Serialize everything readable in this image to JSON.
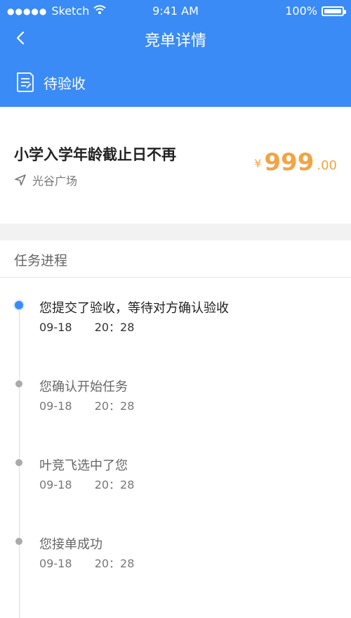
{
  "statusbar": {
    "carrier": "Sketch",
    "time": "9:41 AM",
    "battery": "100%"
  },
  "navbar": {
    "title": "竞单详情"
  },
  "status": {
    "label": "待验收"
  },
  "order": {
    "title": "小学入学年龄截止日不再",
    "location": "光谷广场",
    "price_symbol": "¥",
    "price_int": "999",
    "price_dec": ".00"
  },
  "progress": {
    "title": "任务进程",
    "steps": [
      {
        "text": "您提交了验收，等待对方确认验收",
        "date": "09-18",
        "time": "20：28",
        "active": true
      },
      {
        "text": "您确认开始任务",
        "date": "09-18",
        "time": "20：28",
        "active": false
      },
      {
        "text": "叶竞飞选中了您",
        "date": "09-18",
        "time": "20：28",
        "active": false
      },
      {
        "text": "您接单成功",
        "date": "09-18",
        "time": "20：28",
        "active": false
      }
    ]
  },
  "colors": {
    "header": "#3a8bf5",
    "price": "#f2a443",
    "active_dot": "#3a8bf5"
  },
  "icons": {
    "back": "chevron-left-icon",
    "status": "document-icon",
    "location": "navigation-arrow-icon",
    "wifi": "wifi-icon",
    "battery": "battery-icon"
  }
}
